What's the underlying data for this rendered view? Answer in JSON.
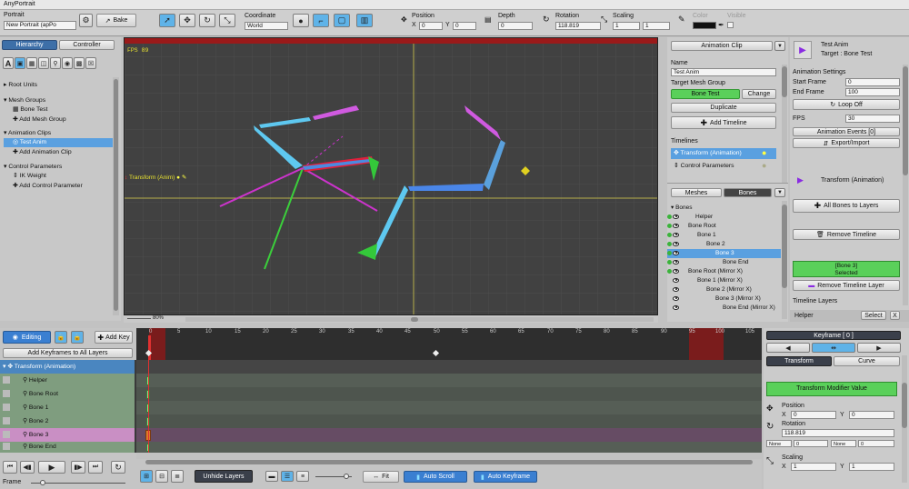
{
  "app": {
    "title": "AnyPortrait"
  },
  "toolbar": {
    "portrait_label": "Portrait",
    "portrait_value": "New Portrait (apPo",
    "bake_label": "Bake",
    "coordinate_label": "Coordinate",
    "coordinate_value": "World",
    "position_label": "Position",
    "pos_x_label": "X",
    "pos_x": "0",
    "pos_y_label": "Y",
    "pos_y": "0",
    "depth_label": "Depth",
    "depth_value": "0",
    "rotation_label": "Rotation",
    "rotation_value": "118.819",
    "scaling_label": "Scaling",
    "scale_x": "1",
    "scale_y": "1",
    "color_label": "Color",
    "visible_label": "Visible"
  },
  "hierarchy": {
    "tab_hierarchy": "Hierarchy",
    "tab_controller": "Controller",
    "sections": [
      {
        "header": "Root Units",
        "items": []
      },
      {
        "header": "Mesh Groups",
        "items": [
          "Bone Test",
          "Add Mesh Group"
        ]
      },
      {
        "header": "Animation Clips",
        "items": [
          "Test Anim",
          "Add Animation Clip"
        ]
      },
      {
        "header": "Control Parameters",
        "items": [
          "IK Weight",
          "Add Control Parameter"
        ]
      }
    ]
  },
  "viewport": {
    "fps": "FPS 89",
    "zoom": "80%",
    "transform_tag": "Transform (Anim)"
  },
  "animclip": {
    "title": "Animation Clip",
    "name_label": "Name",
    "name_value": "Test Anim",
    "target_label": "Target Mesh Group",
    "target_value": "Bone Test",
    "change_label": "Change",
    "duplicate_label": "Duplicate",
    "add_timeline_label": "Add Timeline",
    "timelines_label": "Timelines",
    "timelines": [
      "Transform (Animation)",
      "Control Parameters"
    ],
    "tab_meshes": "Meshes",
    "tab_bones": "Bones",
    "bones_header": "Bones",
    "bones": [
      "Helper",
      "Bone Root",
      "Bone 1",
      "Bone 2",
      "Bone 3",
      "Bone End",
      "Bone Root (Mirror X)",
      "Bone 1 (Mirror X)",
      "Bone 2 (Mirror X)",
      "Bone 3 (Mirror X)",
      "Bone End (Mirror X)"
    ]
  },
  "inspector": {
    "title": "Test Anim",
    "target": "Target : Bone Test",
    "settings_label": "Animation Settings",
    "start_label": "Start Frame",
    "start_value": "0",
    "end_label": "End Frame",
    "end_value": "100",
    "loop_label": "Loop Off",
    "fps_label": "FPS",
    "fps_value": "30",
    "events_label": "Animation Events [0]",
    "export_label": "Export/Import",
    "transform_label": "Transform (Animation)",
    "all_bones_label": "All Bones to Layers",
    "remove_timeline_label": "Remove Timeline",
    "selected_name": "[Bone 3]",
    "selected_label": "Selected",
    "remove_layer_label": "Remove Timeline Layer",
    "layers_label": "Timeline Layers",
    "helper_label": "Helper",
    "select_label": "Select",
    "close_label": "X"
  },
  "timeline": {
    "editing_label": "Editing",
    "add_key_label": "Add Key",
    "add_keyframes_label": "Add Keyframes to All Layers",
    "layer_header": "Transform (Animation)",
    "layers": [
      "Helper",
      "Bone Root",
      "Bone 1",
      "Bone 2",
      "Bone 3",
      "Bone End"
    ],
    "ruler": [
      "0",
      "5",
      "10",
      "15",
      "20",
      "25",
      "30",
      "35",
      "40",
      "45",
      "50",
      "55",
      "60",
      "65",
      "70",
      "75",
      "80",
      "85",
      "90",
      "95",
      "100",
      "105"
    ],
    "frame_label": "Frame"
  },
  "bottombar": {
    "unhide_label": "Unhide Layers",
    "fit_label": "Fit",
    "auto_scroll_label": "Auto Scroll",
    "auto_keyframe_label": "Auto Keyframe"
  },
  "keyframe": {
    "title": "Keyframe [ 0 ]",
    "tab_transform": "Transform",
    "tab_curve": "Curve",
    "modifier_label": "Transform Modifier Value",
    "position_label": "Position",
    "x_label": "X",
    "x_value": "0",
    "y_label": "Y",
    "y_value": "0",
    "rotation_label": "Rotation",
    "rotation_value": "118.819",
    "none1": "None",
    "num1": "0",
    "none2": "None",
    "num2": "0",
    "scaling_label": "Scaling",
    "sx_label": "X",
    "sx_value": "1",
    "sy_label": "Y",
    "sy_value": "1"
  }
}
